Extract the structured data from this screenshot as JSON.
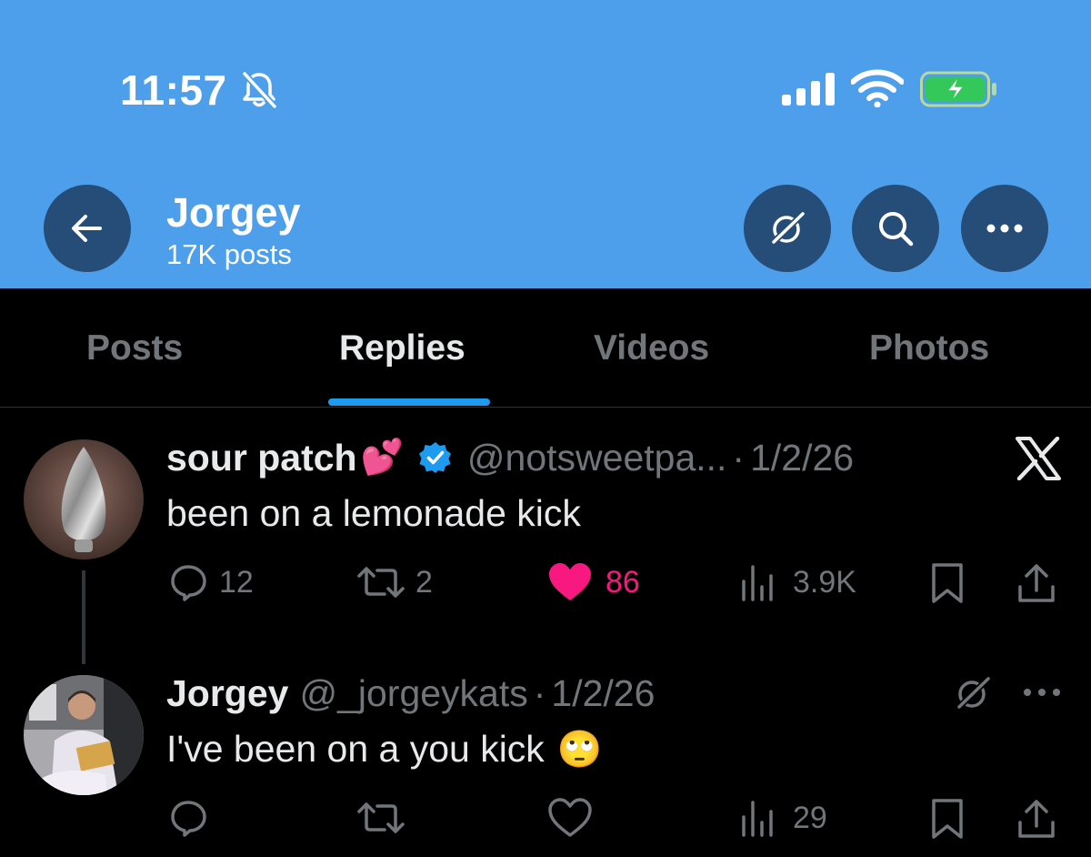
{
  "status_bar": {
    "time": "11:57"
  },
  "profile_header": {
    "name": "Jorgey",
    "posts_count": "17K posts"
  },
  "tabs": [
    {
      "label": "Posts",
      "active": false
    },
    {
      "label": "Replies",
      "active": true
    },
    {
      "label": "Videos",
      "active": false
    },
    {
      "label": "Photos",
      "active": false
    }
  ],
  "tweets": [
    {
      "display_name": "sour patch",
      "name_emoji": "💕",
      "verified": true,
      "handle": "@notsweetpa...",
      "separator": "·",
      "date": "1/2/26",
      "text": "been on a lemonade kick",
      "replies": "12",
      "reposts": "2",
      "likes": "86",
      "views": "3.9K",
      "liked": true
    },
    {
      "display_name": "Jorgey",
      "handle": "@_jorgeykats",
      "separator": "·",
      "date": "1/2/26",
      "text": "I've been on a you kick",
      "text_emoji": "🙄",
      "views": "29",
      "liked": false
    }
  ],
  "colors": {
    "header_bg": "#4d9fec",
    "header_button": "#254d77",
    "accent": "#1d9bf0",
    "like": "#f91880",
    "muted": "#71767b",
    "battery_fill": "#34c759"
  }
}
